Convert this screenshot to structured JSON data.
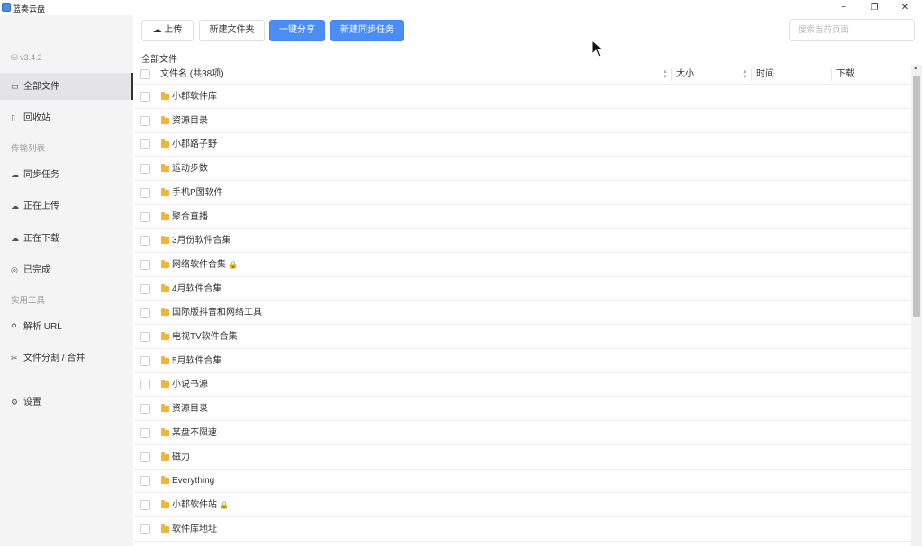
{
  "window": {
    "title": "蓝奏云盘",
    "minimize": "−",
    "maximize": "❐",
    "close": "✕"
  },
  "sidebar": {
    "version": "v3.4.2",
    "items": [
      {
        "label": "全部文件",
        "icon": "folder-open-icon",
        "glyph": "⌂",
        "active": true
      },
      {
        "label": "回收站",
        "icon": "trash-icon",
        "glyph": "🗑",
        "active": false
      }
    ],
    "transfer_header": "传输列表",
    "transfer_items": [
      {
        "label": "同步任务",
        "icon": "sync-icon",
        "glyph": "☁"
      },
      {
        "label": "正在上传",
        "icon": "cloud-upload-icon",
        "glyph": "☁"
      },
      {
        "label": "正在下载",
        "icon": "cloud-download-icon",
        "glyph": "☁"
      },
      {
        "label": "已完成",
        "icon": "check-circle-icon",
        "glyph": "✓"
      }
    ],
    "tools_header": "实用工具",
    "tool_items": [
      {
        "label": "解析 URL",
        "icon": "link-icon",
        "glyph": "⚲"
      },
      {
        "label": "文件分割 / 合并",
        "icon": "scissors-icon",
        "glyph": "✂"
      }
    ],
    "settings": {
      "label": "设置",
      "icon": "gear-icon",
      "glyph": "⚙"
    }
  },
  "toolbar": {
    "upload_label": "上传",
    "new_folder_label": "新建文件夹",
    "share_label": "一键分享",
    "new_sync_label": "新建同步任务",
    "search_placeholder": "搜索当前页面"
  },
  "breadcrumb": "全部文件",
  "table": {
    "columns": {
      "name": "文件名 (共38项)",
      "size": "大小",
      "time": "时间",
      "download": "下载"
    },
    "rows": [
      {
        "name": "小郡软件库",
        "locked": false
      },
      {
        "name": "资源目录",
        "locked": false
      },
      {
        "name": "小郡路子野",
        "locked": false
      },
      {
        "name": "运动步数",
        "locked": false
      },
      {
        "name": "手机P图软件",
        "locked": false
      },
      {
        "name": "聚合直播",
        "locked": false
      },
      {
        "name": "3月份软件合集",
        "locked": false
      },
      {
        "name": "网络软件合集",
        "locked": true
      },
      {
        "name": "4月软件合集",
        "locked": false
      },
      {
        "name": "国际版抖音和网络工具",
        "locked": false
      },
      {
        "name": "电视TV软件合集",
        "locked": false
      },
      {
        "name": "5月软件合集",
        "locked": false
      },
      {
        "name": "小说书源",
        "locked": false
      },
      {
        "name": "资源目录",
        "locked": false
      },
      {
        "name": "某盘不限速",
        "locked": false
      },
      {
        "name": "磁力",
        "locked": false
      },
      {
        "name": "Everything",
        "locked": false
      },
      {
        "name": "小郡软件站",
        "locked": true
      },
      {
        "name": "软件库地址",
        "locked": false
      }
    ]
  }
}
